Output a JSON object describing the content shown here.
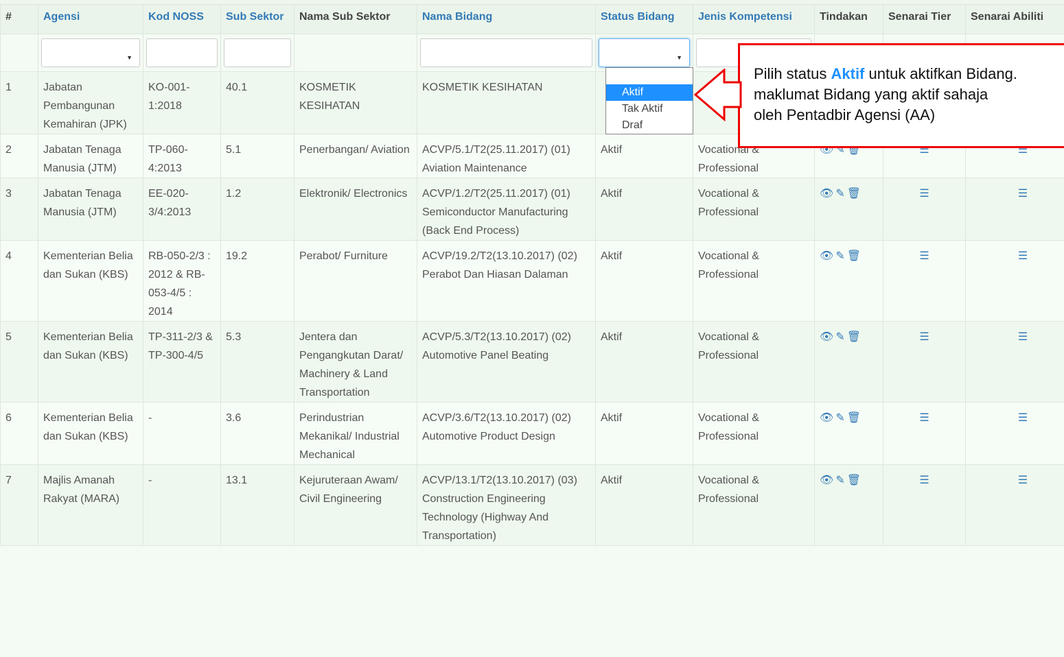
{
  "table": {
    "headers": [
      "#",
      "Agensi",
      "Kod NOSS",
      "Sub Sektor",
      "Nama Sub Sektor",
      "Nama Bidang",
      "Status Bidang",
      "Jenis Kompetensi",
      "Tindakan",
      "Senarai Tier",
      "Senarai Abiliti"
    ],
    "rows": [
      {
        "no": "1",
        "agensi": "Jabatan Pembangunan Kemahiran (JPK)",
        "kod": "KO-001-1:2018",
        "sub": "40.1",
        "nama_sub": "KOSMETIK KESIHATAN",
        "bidang": "KOSMETIK KESIHATAN",
        "status": "",
        "jenis": ""
      },
      {
        "no": "2",
        "agensi": "Jabatan Tenaga Manusia (JTM)",
        "kod": "TP-060-4:2013",
        "sub": "5.1",
        "nama_sub": "Penerbangan/ Aviation",
        "bidang": "ACVP/5.1/T2(25.11.2017) (01) Aviation Maintenance",
        "status": "Aktif",
        "jenis": "Vocational & Professional"
      },
      {
        "no": "3",
        "agensi": "Jabatan Tenaga Manusia (JTM)",
        "kod": "EE-020-3/4:2013",
        "sub": "1.2",
        "nama_sub": "Elektronik/ Electronics",
        "bidang": "ACVP/1.2/T2(25.11.2017) (01) Semiconductor Manufacturing (Back End Process)",
        "status": "Aktif",
        "jenis": "Vocational & Professional"
      },
      {
        "no": "4",
        "agensi": "Kementerian Belia dan Sukan (KBS)",
        "kod": "RB-050-2/3 : 2012 & RB-053-4/5 : 2014",
        "sub": "19.2",
        "nama_sub": "Perabot/ Furniture",
        "bidang": "ACVP/19.2/T2(13.10.2017) (02) Perabot Dan Hiasan Dalaman",
        "status": "Aktif",
        "jenis": "Vocational & Professional"
      },
      {
        "no": "5",
        "agensi": "Kementerian Belia dan Sukan (KBS)",
        "kod": "TP-311-2/3 & TP-300-4/5",
        "sub": "5.3",
        "nama_sub": "Jentera dan Pengangkutan Darat/ Machinery & Land Transportation",
        "bidang": "ACVP/5.3/T2(13.10.2017) (02) Automotive Panel Beating",
        "status": "Aktif",
        "jenis": "Vocational & Professional"
      },
      {
        "no": "6",
        "agensi": "Kementerian Belia dan Sukan (KBS)",
        "kod": "-",
        "sub": "3.6",
        "nama_sub": "Perindustrian Mekanikal/ Industrial Mechanical",
        "bidang": "ACVP/3.6/T2(13.10.2017) (02) Automotive Product Design",
        "status": "Aktif",
        "jenis": "Vocational & Professional"
      },
      {
        "no": "7",
        "agensi": "Majlis Amanah Rakyat (MARA)",
        "kod": "-",
        "sub": "13.1",
        "nama_sub": "Kejuruteraan Awam/ Civil Engineering",
        "bidang": "ACVP/13.1/T2(13.10.2017) (03) Construction Engineering Technology (Highway And Transportation)",
        "status": "Aktif",
        "jenis": "Vocational & Professional"
      }
    ]
  },
  "dropdown": {
    "options": [
      "",
      "Aktif",
      "Tak Aktif",
      "Draf"
    ],
    "selected": "Aktif"
  },
  "callout": {
    "line1_pre": "Pilih status ",
    "line1_bold": "Aktif",
    "line1_post": " untuk aktifkan Bidang.",
    "line2": "maklumat Bidang yang aktif sahaja",
    "line3": "oleh Pentadbir Agensi (AA)"
  },
  "icons": {
    "view": "eye-icon",
    "edit": "pencil-icon",
    "delete": "trash-icon",
    "list": "list-icon"
  },
  "colors": {
    "link_blue": "#337ab7",
    "highlight_blue": "#1e90ff",
    "callout_red": "#e00000"
  }
}
